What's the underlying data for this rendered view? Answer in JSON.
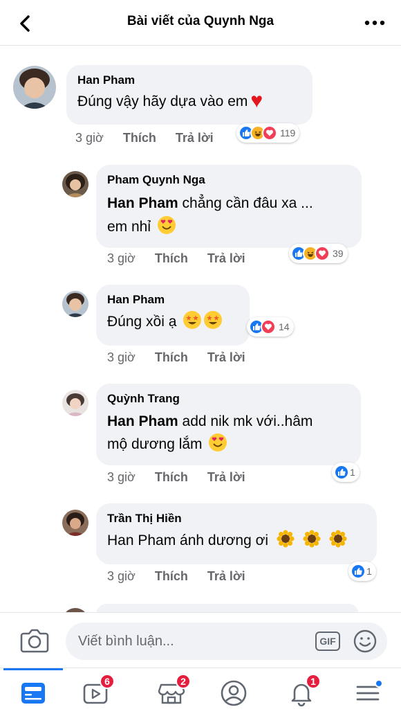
{
  "header": {
    "title": "Bài viết của Quynh Nga"
  },
  "comments": [
    {
      "author": "Han Pham",
      "text": "Đúng vậy hãy dựa vào em",
      "time": "3 giờ",
      "like": "Thích",
      "reply": "Trả lời",
      "reaction_count": "119"
    },
    {
      "author": "Pham Quynh Nga",
      "mention": "Han Pham",
      "text_line1": "chẳng cần đâu xa ...",
      "text_line2": "em nhỉ",
      "time": "3 giờ",
      "like": "Thích",
      "reply": "Trả lời",
      "reaction_count": "39"
    },
    {
      "author": "Han Pham",
      "text": "Đúng xồi ạ",
      "time": "3 giờ",
      "like": "Thích",
      "reply": "Trả lời",
      "reaction_count": "14"
    },
    {
      "author": "Quỳnh Trang",
      "mention": "Han Pham",
      "text_line1": "add nik mk với..hâm",
      "text_line2": "mộ dương lắm",
      "time": "3 giờ",
      "like": "Thích",
      "reply": "Trả lời",
      "reaction_count": "1"
    },
    {
      "author": "Trần Thị Hiền",
      "text": "Han Pham ánh dương ơi",
      "time": "3 giờ",
      "like": "Thích",
      "reply": "Trả lời",
      "reaction_count": "1"
    }
  ],
  "composer": {
    "placeholder": "Viết bình luận...",
    "gif_label": "GIF"
  },
  "tabbar": {
    "video_badge": "6",
    "marketplace_badge": "2",
    "notifications_badge": "1"
  },
  "colors": {
    "accent": "#1877f2",
    "badge": "#e41e3f",
    "bubble": "#f0f2f5"
  }
}
